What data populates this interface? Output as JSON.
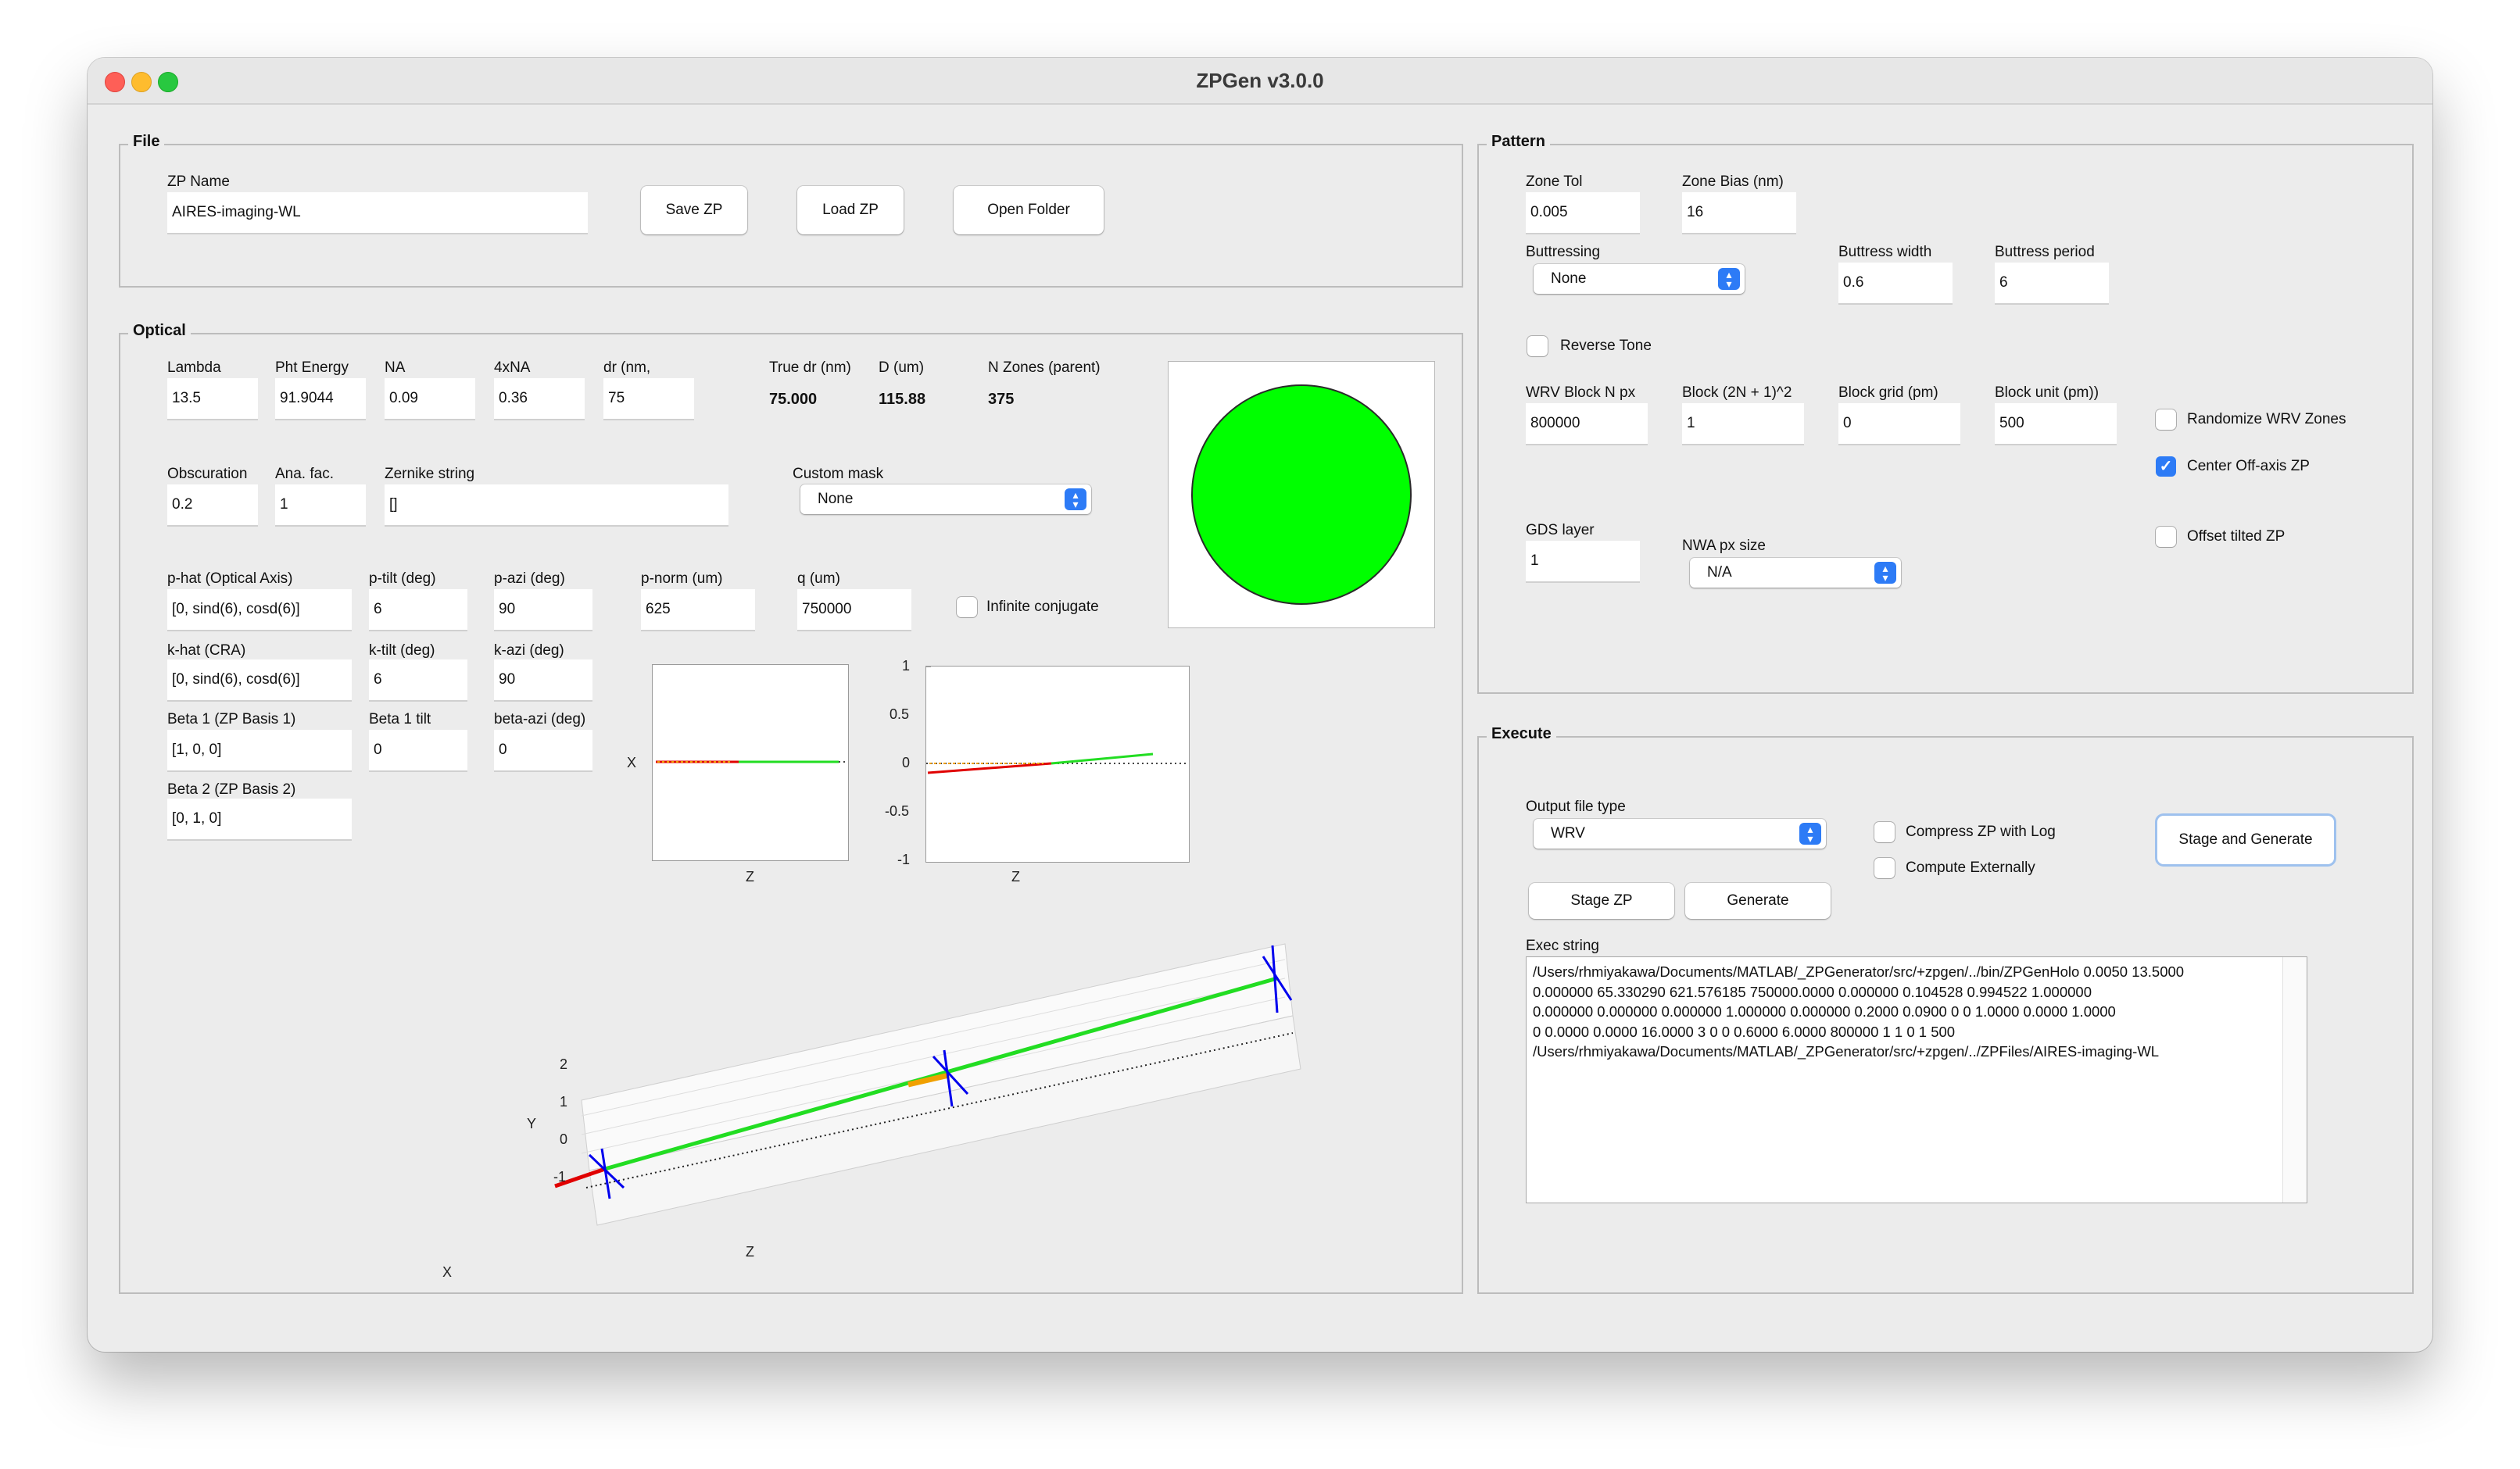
{
  "window": {
    "title": "ZPGen v3.0.0"
  },
  "file": {
    "title": "File",
    "zp_name_label": "ZP Name",
    "zp_name": "AIRES-imaging-WL",
    "save_btn": "Save ZP",
    "load_btn": "Load ZP",
    "open_btn": "Open Folder"
  },
  "optical": {
    "title": "Optical",
    "lambda_label": "Lambda",
    "lambda": "13.5",
    "pht_label": "Pht Energy",
    "pht": "91.9044",
    "na_label": "NA",
    "na": "0.09",
    "na4_label": "4xNA",
    "na4": "0.36",
    "dr_label": "dr (nm,",
    "dr": "75",
    "true_dr_label": "True dr (nm)",
    "true_dr": "75.000",
    "d_label": "D (um)",
    "d": "115.88",
    "nz_label": "N Zones (parent)",
    "nz": "375",
    "obsc_label": "Obscuration",
    "obsc": "0.2",
    "ana_label": "Ana. fac.",
    "ana": "1",
    "zern_label": "Zernike string",
    "zern": "[]",
    "mask_label": "Custom mask",
    "mask": "None",
    "phat_label": "p-hat (Optical Axis)",
    "phat": "[0, sind(6), cosd(6)]",
    "ptilt_label": "p-tilt  (deg)",
    "ptilt": "6",
    "pazi_label": "p-azi (deg)",
    "pazi": "90",
    "pnorm_label": "p-norm (um)",
    "pnorm": "625",
    "q_label": "q (um)",
    "q": "750000",
    "inf_label": "Infinite conjugate",
    "khat_label": "k-hat (CRA)",
    "khat": "[0, sind(6), cosd(6)]",
    "ktilt_label": "k-tilt (deg)",
    "ktilt": "6",
    "kazi_label": "k-azi (deg)",
    "kazi": "90",
    "b1_label": "Beta 1 (ZP Basis 1)",
    "b1": "[1, 0, 0]",
    "b1tilt_label": "Beta 1 tilt",
    "b1tilt": "0",
    "bazi_label": "beta-azi (deg)",
    "bazi": "0",
    "b2_label": "Beta 2 (ZP Basis 2)",
    "b2": "[0, 1, 0]",
    "plot1": {
      "ylabel": "X",
      "xlabel": "Z"
    },
    "plot2": {
      "xlabel": "Z",
      "yticks": [
        "1",
        "0.5",
        "0",
        "-0.5",
        "-1"
      ]
    },
    "plot3d": {
      "xlabel": "X",
      "ylabel": "Y",
      "zlabel": "Z",
      "yticks": [
        "2",
        "1",
        "0",
        "-1"
      ]
    }
  },
  "pattern": {
    "title": "Pattern",
    "ztol_label": "Zone Tol",
    "ztol": "0.005",
    "zbias_label": "Zone Bias (nm)",
    "zbias": "16",
    "butt_label": "Buttressing",
    "butt": "None",
    "bwidth_label": "Buttress width",
    "bwidth": "0.6",
    "bperiod_label": "Buttress period",
    "bperiod": "6",
    "reverse_label": "Reverse Tone",
    "wrvn_label": "WRV Block N px",
    "wrvn": "800000",
    "block_label": "Block (2N + 1)^2",
    "block": "1",
    "bgrid_label": "Block grid (pm)",
    "bgrid": "0",
    "bunit_label": "Block unit (pm))",
    "bunit": "500",
    "random_label": "Randomize WRV Zones",
    "center_label": "Center Off-axis ZP",
    "gds_label": "GDS layer",
    "gds": "1",
    "nwa_label": "NWA px size",
    "nwa": "N/A",
    "offset_label": "Offset tilted ZP"
  },
  "execute": {
    "title": "Execute",
    "out_label": "Output file type",
    "out": "WRV",
    "compress_label": "Compress ZP with Log",
    "compute_label": "Compute Externally",
    "stage_gen_btn": "Stage and Generate",
    "stage_btn": "Stage ZP",
    "gen_btn": "Generate",
    "exec_label": "Exec string",
    "exec_lines": [
      "/Users/rhmiyakawa/Documents/MATLAB/_ZPGenerator/src/+zpgen/../bin/ZPGenHolo 0.0050  13.5000",
      "0.000000 65.330290 621.576185   750000.0000  0.000000 0.104528 0.994522   1.000000",
      "0.000000 0.000000   0.000000 1.000000 0.000000   0.2000  0.0900  0  0  1.0000  0.0000  1.0000",
      "0  0.0000  0.0000  16.0000  3  0  0  0.6000  6.0000  800000  1  1  0  1  500",
      "/Users/rhmiyakawa/Documents/MATLAB/_ZPGenerator/src/+zpgen/../ZPFiles/AIRES-imaging-WL"
    ]
  }
}
